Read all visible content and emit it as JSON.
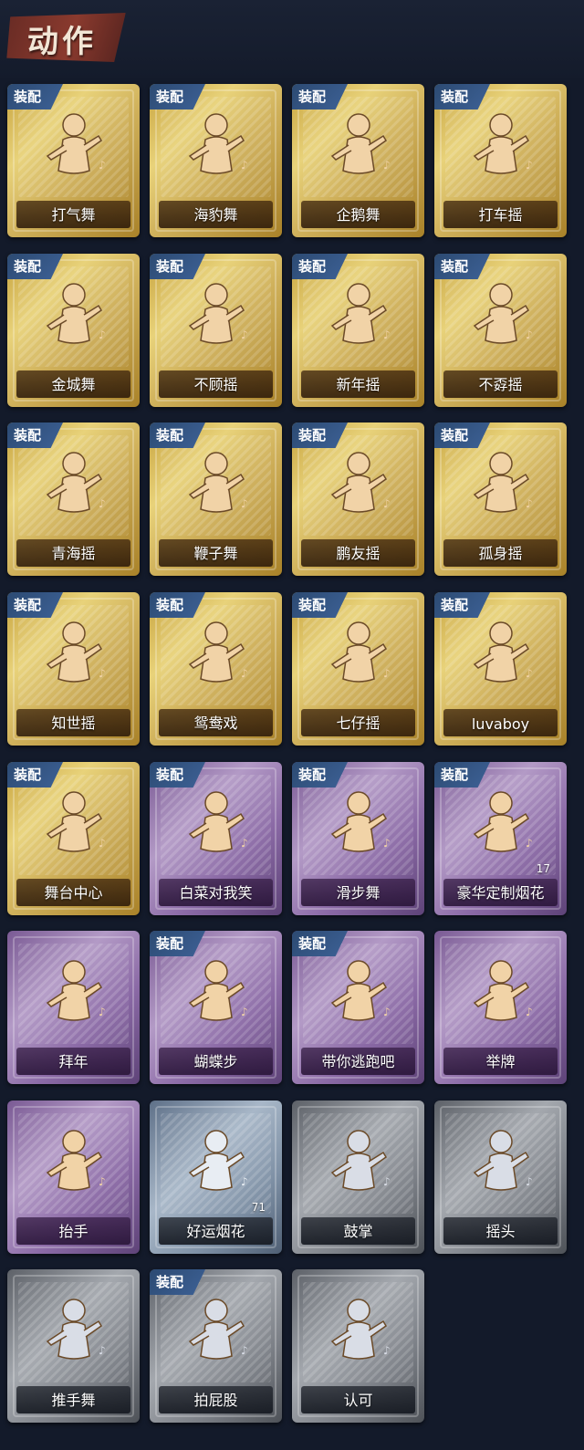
{
  "header": {
    "title": "动作"
  },
  "equip_label": "装配",
  "items": [
    {
      "label": "打气舞",
      "tier": "gold",
      "equipped": true,
      "icon": "dance-pose-icon"
    },
    {
      "label": "海豹舞",
      "tier": "gold",
      "equipped": true,
      "icon": "dance-pose-icon"
    },
    {
      "label": "企鹅舞",
      "tier": "gold",
      "equipped": true,
      "icon": "dance-pose-icon"
    },
    {
      "label": "打车摇",
      "tier": "gold",
      "equipped": true,
      "icon": "dance-pose-icon"
    },
    {
      "label": "金城舞",
      "tier": "gold",
      "equipped": true,
      "icon": "dance-pose-icon"
    },
    {
      "label": "不顾摇",
      "tier": "gold",
      "equipped": true,
      "icon": "dance-pose-icon"
    },
    {
      "label": "新年摇",
      "tier": "gold",
      "equipped": true,
      "icon": "dance-pose-icon"
    },
    {
      "label": "不孬摇",
      "tier": "gold",
      "equipped": true,
      "icon": "dance-pose-icon"
    },
    {
      "label": "青海摇",
      "tier": "gold",
      "equipped": true,
      "icon": "dance-pose-icon"
    },
    {
      "label": "鞭子舞",
      "tier": "gold",
      "equipped": true,
      "icon": "dance-pose-icon"
    },
    {
      "label": "鹏友摇",
      "tier": "gold",
      "equipped": true,
      "icon": "dance-pose-icon"
    },
    {
      "label": "孤身摇",
      "tier": "gold",
      "equipped": true,
      "icon": "dance-pose-icon"
    },
    {
      "label": "知世摇",
      "tier": "gold",
      "equipped": true,
      "icon": "dance-pose-icon"
    },
    {
      "label": "鸳鸯戏",
      "tier": "gold",
      "equipped": true,
      "icon": "dance-pose-icon"
    },
    {
      "label": "七仔摇",
      "tier": "gold",
      "equipped": true,
      "icon": "dance-pose-icon"
    },
    {
      "label": "luvaboy",
      "tier": "gold",
      "equipped": true,
      "icon": "dance-pose-icon"
    },
    {
      "label": "舞台中心",
      "tier": "gold",
      "equipped": true,
      "icon": "dance-pose-icon"
    },
    {
      "label": "白菜对我笑",
      "tier": "purple",
      "equipped": true,
      "icon": "dance-pose-icon"
    },
    {
      "label": "滑步舞",
      "tier": "purple",
      "equipped": true,
      "icon": "dance-pose-icon"
    },
    {
      "label": "豪华定制烟花",
      "tier": "purple",
      "equipped": true,
      "icon": "firework-box-icon",
      "count": "17"
    },
    {
      "label": "拜年",
      "tier": "purple",
      "equipped": false,
      "icon": "greeting-pose-icon"
    },
    {
      "label": "蝴蝶步",
      "tier": "purple",
      "equipped": true,
      "icon": "dance-pose-icon"
    },
    {
      "label": "带你逃跑吧",
      "tier": "purple",
      "equipped": true,
      "icon": "dance-pose-icon"
    },
    {
      "label": "举牌",
      "tier": "purple",
      "equipped": false,
      "icon": "hold-sign-icon"
    },
    {
      "label": "抬手",
      "tier": "purple",
      "equipped": false,
      "icon": "raise-hand-icon"
    },
    {
      "label": "好运烟花",
      "tier": "blue",
      "equipped": false,
      "icon": "firework-can-icon",
      "count": "71"
    },
    {
      "label": "鼓掌",
      "tier": "gray",
      "equipped": false,
      "icon": "clap-icon"
    },
    {
      "label": "摇头",
      "tier": "gray",
      "equipped": false,
      "icon": "shake-head-icon"
    },
    {
      "label": "推手舞",
      "tier": "gray",
      "equipped": false,
      "icon": "push-hands-icon"
    },
    {
      "label": "拍屁股",
      "tier": "gray",
      "equipped": true,
      "icon": "pat-icon"
    },
    {
      "label": "认可",
      "tier": "gray",
      "equipped": false,
      "icon": "thumbs-up-icon"
    }
  ]
}
